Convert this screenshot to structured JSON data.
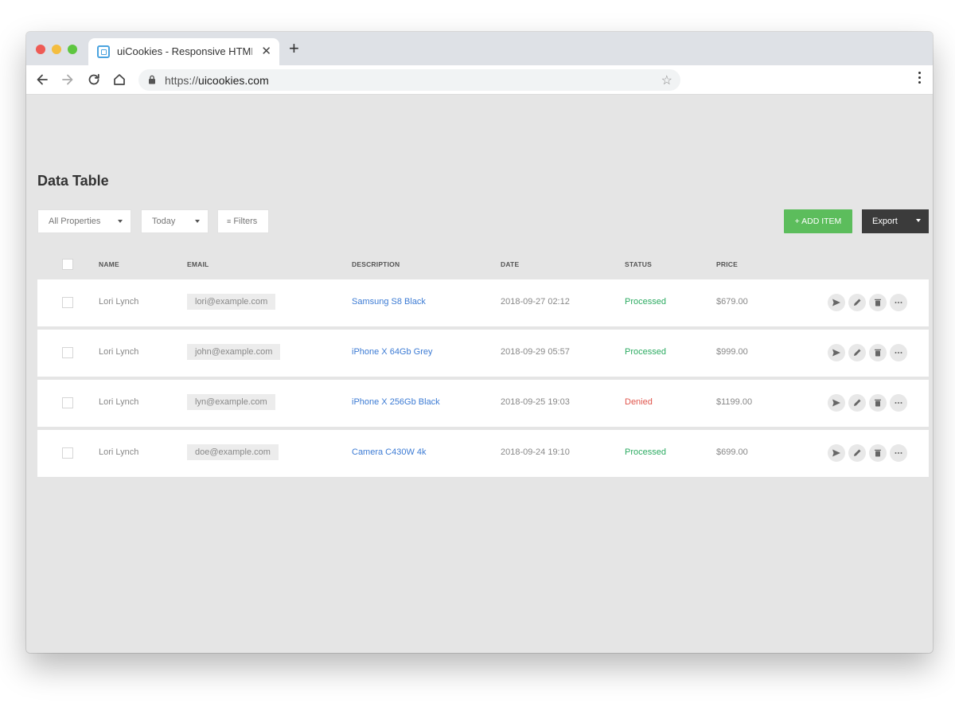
{
  "browser": {
    "tab_title": "uiCookies - Responsive HTML",
    "url_scheme": "https://",
    "url_host": "uicookies.com"
  },
  "page": {
    "title": "Data Table",
    "filters": {
      "properties": "All Properties",
      "period": "Today",
      "filters_label": "Filters"
    },
    "add_item": "+ ADD ITEM",
    "export": "Export"
  },
  "table": {
    "columns": [
      "NAME",
      "EMAIL",
      "DESCRIPTION",
      "DATE",
      "STATUS",
      "PRICE"
    ],
    "rows": [
      {
        "name": "Lori Lynch",
        "email": "lori@example.com",
        "description": "Samsung S8 Black",
        "date": "2018-09-27 02:12",
        "status": "Processed",
        "price": "$679.00"
      },
      {
        "name": "Lori Lynch",
        "email": "john@example.com",
        "description": "iPhone X 64Gb Grey",
        "date": "2018-09-29 05:57",
        "status": "Processed",
        "price": "$999.00"
      },
      {
        "name": "Lori Lynch",
        "email": "lyn@example.com",
        "description": "iPhone X 256Gb Black",
        "date": "2018-09-25 19:03",
        "status": "Denied",
        "price": "$1199.00"
      },
      {
        "name": "Lori Lynch",
        "email": "doe@example.com",
        "description": "Camera C430W 4k",
        "date": "2018-09-24 19:10",
        "status": "Processed",
        "price": "$699.00"
      }
    ]
  },
  "colors": {
    "processed": "#2bab61",
    "denied": "#e0554c",
    "add_button": "#5cbd5c",
    "export_button": "#3b3b3b",
    "link": "#3c7bd4"
  },
  "icons": {
    "row_actions": [
      "send-icon",
      "edit-icon",
      "delete-icon",
      "more-icon"
    ]
  }
}
